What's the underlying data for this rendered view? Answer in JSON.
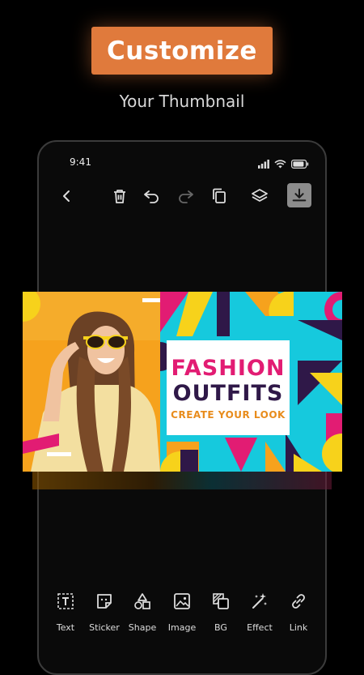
{
  "promo": {
    "headline": "Customize",
    "subheadline": "Your Thumbnail"
  },
  "status_bar": {
    "time": "9:41"
  },
  "toolbar": {
    "icons": [
      "back-icon",
      "trash-icon",
      "undo-icon",
      "redo-icon",
      "copy-icon",
      "layers-icon",
      "download-icon"
    ]
  },
  "thumbnail": {
    "line1": "FASHION",
    "line2": "OUTFITS",
    "line3": "CREATE YOUR LOOK",
    "colors": {
      "orange": "#f6a21d",
      "cyan": "#16c9dd",
      "pink": "#e21c73",
      "purple": "#2f1848",
      "yellow": "#f7d21b"
    }
  },
  "tools": [
    {
      "label": "Text",
      "icon": "text-icon"
    },
    {
      "label": "Sticker",
      "icon": "sticker-icon"
    },
    {
      "label": "Shape",
      "icon": "shape-icon"
    },
    {
      "label": "Image",
      "icon": "image-icon"
    },
    {
      "label": "BG",
      "icon": "background-icon"
    },
    {
      "label": "Effect",
      "icon": "effect-icon"
    },
    {
      "label": "Link",
      "icon": "link-icon"
    }
  ],
  "colors": {
    "accent": "#e07a3c",
    "background": "#000000"
  }
}
